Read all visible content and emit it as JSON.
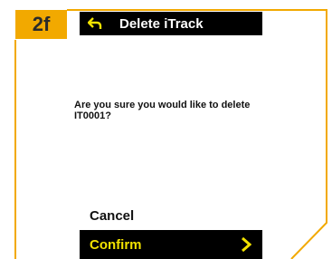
{
  "step": {
    "label": "2f"
  },
  "header": {
    "title": "Delete iTrack",
    "back_icon": "back-arrow-icon"
  },
  "dialog": {
    "message": "Are you sure you would like to delete IT0001?"
  },
  "actions": {
    "cancel_label": "Cancel",
    "confirm_label": "Confirm",
    "confirm_icon": "chevron-right-icon"
  },
  "colors": {
    "accent": "#f2a900",
    "confirm_text": "#f2e200",
    "header_bg": "#000000"
  }
}
